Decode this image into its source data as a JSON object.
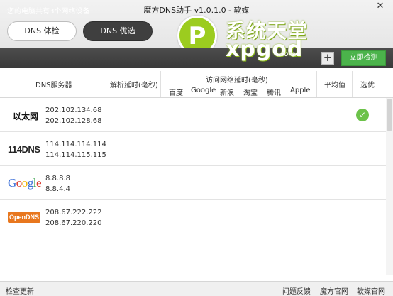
{
  "window": {
    "title": "魔方DNS助手 v1.0.1.0 - 软媒",
    "minimize_glyph": "—",
    "close_glyph": "✕"
  },
  "tabs": [
    {
      "label": "DNS 体检",
      "active": false
    },
    {
      "label": "DNS 优选",
      "active": true
    }
  ],
  "watermark": {
    "cn": "系统天堂",
    "en": "xpgod",
    "com": ".com",
    "badge": "P"
  },
  "status": {
    "text": "您的电脑共有3个网络设备",
    "add_glyph": "+",
    "detect_label": "立即检测",
    "accent": "#4bb34b"
  },
  "table": {
    "headers": {
      "server": "DNS服务器",
      "resolve": "解析延时(毫秒)",
      "access": "访问网络延时(毫秒)",
      "sites": [
        "百度",
        "Google",
        "新浪",
        "淘宝",
        "腾讯",
        "Apple"
      ],
      "average": "平均值",
      "select": "选优"
    },
    "rows": [
      {
        "provider": "以太网",
        "ips": [
          "202.102.134.68",
          "202.102.128.68"
        ],
        "selected": true
      },
      {
        "provider": "114DNS",
        "ips": [
          "114.114.114.114",
          "114.114.115.115"
        ],
        "selected": false
      },
      {
        "provider": "Google",
        "ips": [
          "8.8.8.8",
          "8.8.4.4"
        ],
        "selected": false
      },
      {
        "provider": "OpenDNS",
        "ips": [
          "208.67.222.222",
          "208.67.220.220"
        ],
        "selected": false
      }
    ],
    "check_glyph": "✓"
  },
  "footer": {
    "update": "检查更新",
    "feedback": "问题反馈",
    "site1": "魔方官网",
    "site2": "软媒官网"
  }
}
